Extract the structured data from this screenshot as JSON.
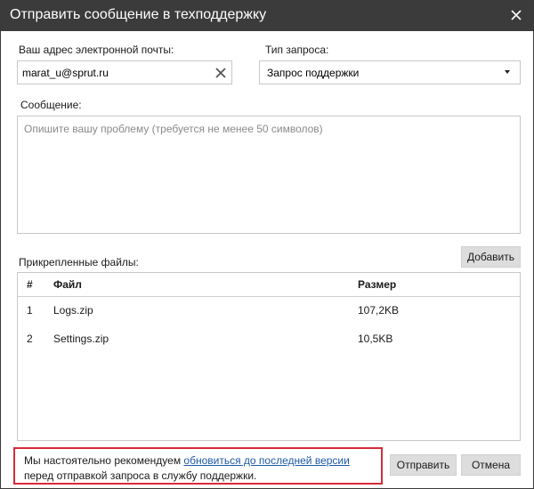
{
  "window": {
    "title": "Отправить сообщение в техподдержку"
  },
  "form": {
    "email_label": "Ваш адрес электронной почты:",
    "email_value": "marat_u@sprut.ru",
    "request_type_label": "Тип запроса:",
    "request_type_value": "Запрос поддержки",
    "message_label": "Сообщение:",
    "message_placeholder": "Опишите вашу проблему (требуется не менее 50 символов)"
  },
  "attachments": {
    "label": "Прикрепленные файлы:",
    "add_button": "Добавить",
    "columns": [
      "#",
      "Файл",
      "Размер"
    ],
    "rows": [
      {
        "num": "1",
        "file": "Logs.zip",
        "size": "107,2KB"
      },
      {
        "num": "2",
        "file": "Settings.zip",
        "size": "10,5KB"
      }
    ]
  },
  "notice": {
    "before": "Мы настоятельно рекомендуем ",
    "link": "обновиться до последней версии",
    "after": " перед отправкой запроса в службу поддержки."
  },
  "buttons": {
    "send": "Отправить",
    "cancel": "Отмена"
  },
  "colors": {
    "titlebar": "#3b3b3b",
    "button": "#dddddd",
    "notice_border": "#d62b3a",
    "link": "#1e5aa6"
  }
}
